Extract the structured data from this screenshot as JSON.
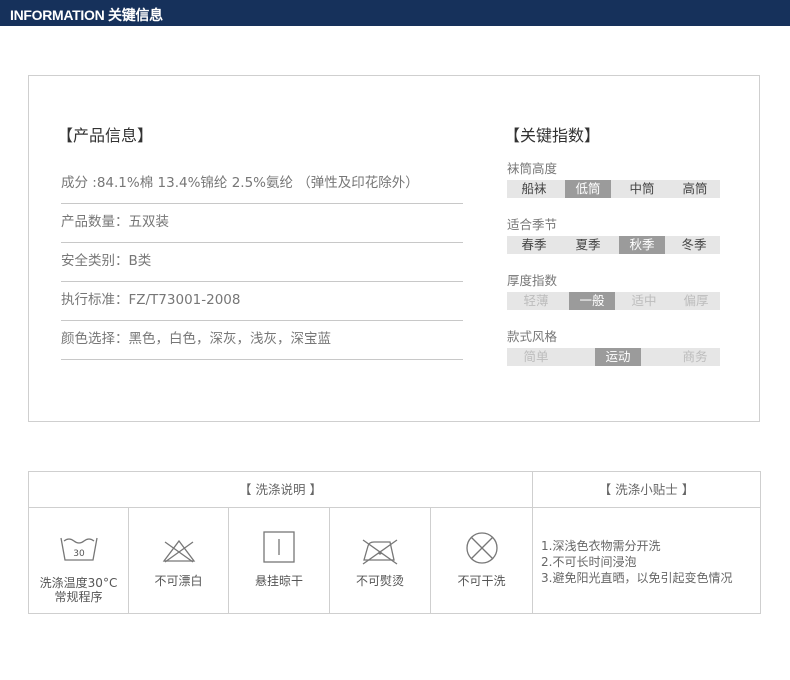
{
  "header": {
    "title": "INFORMATION 关键信息"
  },
  "product_info": {
    "title": "【产品信息】",
    "rows": [
      "成分 :84.1%棉 13.4%锦纶 2.5%氨纶 （弹性及印花除外）",
      "产品数量：五双装",
      "安全类别：B类",
      "执行标准：FZ/T73001-2008",
      "颜色选择：黑色，白色，深灰，浅灰，深宝蓝"
    ]
  },
  "key_index": {
    "title": "【关键指数】",
    "groups": [
      {
        "label": "袜筒高度",
        "options": [
          "船袜",
          "低筒",
          "中筒",
          "高筒"
        ],
        "selected": "低筒"
      },
      {
        "label": "适合季节",
        "options": [
          "春季",
          "夏季",
          "秋季",
          "冬季"
        ],
        "selected": "秋季"
      },
      {
        "label": "厚度指数",
        "options": [
          "轻薄",
          "一般",
          "适中",
          "偏厚"
        ],
        "selected": "一般"
      },
      {
        "label": "款式风格",
        "options": [
          "简单",
          "运动",
          "商务"
        ],
        "selected": "运动"
      }
    ]
  },
  "care": {
    "title": "【 洗涤说明 】",
    "items": [
      {
        "icon": "wash-30-icon",
        "label": "洗涤温度30°C\n常规程序",
        "temp": "30"
      },
      {
        "icon": "no-bleach-icon",
        "label": "不可漂白"
      },
      {
        "icon": "hang-dry-icon",
        "label": "悬挂晾干"
      },
      {
        "icon": "no-iron-icon",
        "label": "不可熨烫"
      },
      {
        "icon": "no-dry-clean-icon",
        "label": "不可干洗"
      }
    ],
    "tips_title": "【 洗涤小贴士 】",
    "tips": [
      "1.深浅色衣物需分开洗",
      "2.不可长时间浸泡",
      "3.避免阳光直晒，以免引起变色情况"
    ]
  },
  "colors": {
    "header_bg": "#16315b",
    "active_segment": "#9b9b9b",
    "scale_bg": "#e6e6e6"
  }
}
